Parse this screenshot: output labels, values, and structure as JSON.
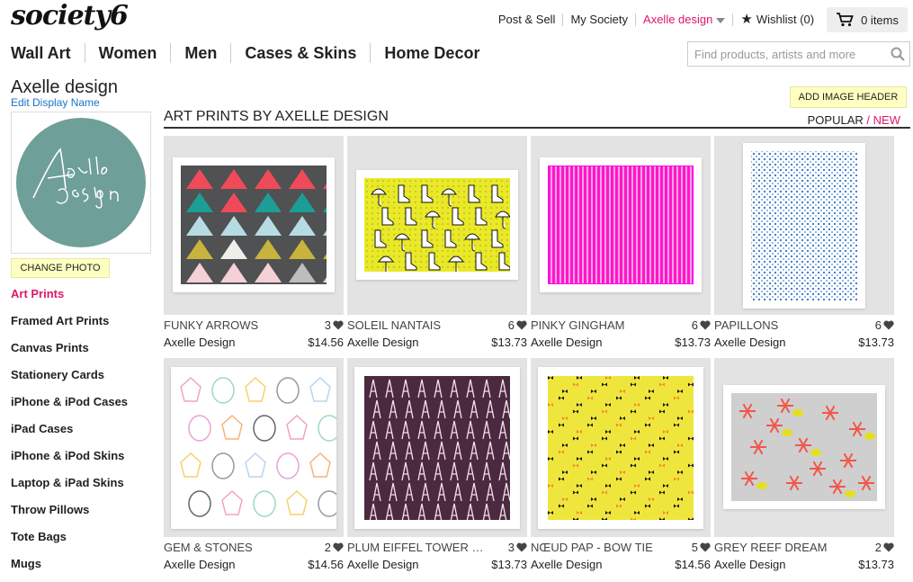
{
  "brand": {
    "logo": "society6"
  },
  "topnav": {
    "post_sell": "Post & Sell",
    "my_society": "My Society",
    "user": "Axelle design",
    "wishlist": "Wishlist (0)",
    "cart": "0 items"
  },
  "mainnav": [
    "Wall Art",
    "Women",
    "Men",
    "Cases & Skins",
    "Home Decor"
  ],
  "search": {
    "placeholder": "Find products, artists and more",
    "value": ""
  },
  "artist": {
    "name": "Axelle design",
    "edit_label": "Edit Display Name",
    "change_photo": "CHANGE PHOTO",
    "avatar_color": "#6e9f98"
  },
  "sidebar": [
    "Art Prints",
    "Framed Art Prints",
    "Canvas Prints",
    "Stationery Cards",
    "iPhone & iPod Cases",
    "iPad Cases",
    "iPhone & iPod Skins",
    "Laptop & iPad Skins",
    "Throw Pillows",
    "Tote Bags",
    "Mugs"
  ],
  "main": {
    "add_image_header": "ADD IMAGE HEADER",
    "section_title": "ART PRINTS BY AXELLE DESIGN",
    "sort_popular": "POPULAR",
    "sort_sep": "/",
    "sort_new": "NEW"
  },
  "colors": {
    "accent": "#e0166a",
    "link": "#1a73c8",
    "highlight": "#ffffc2"
  },
  "products": [
    {
      "title": "FUNKY ARROWS",
      "likes": "3",
      "artist": "Axelle Design",
      "price": "$14.56",
      "pattern": "triangles"
    },
    {
      "title": "SOLEIL NANTAIS",
      "likes": "6",
      "artist": "Axelle Design",
      "price": "$13.73",
      "pattern": "boots"
    },
    {
      "title": "PINKY GINGHAM",
      "likes": "6",
      "artist": "Axelle Design",
      "price": "$13.73",
      "pattern": "gingham"
    },
    {
      "title": "PAPILLONS",
      "likes": "6",
      "artist": "Axelle Design",
      "price": "$13.73",
      "pattern": "papillons"
    },
    {
      "title": "GEM & STONES",
      "likes": "2",
      "artist": "Axelle Design",
      "price": "$14.56",
      "pattern": "gems"
    },
    {
      "title": "PLUM EIFFEL TOWER & ...",
      "likes": "3",
      "artist": "Axelle Design",
      "price": "$13.73",
      "pattern": "eiffel"
    },
    {
      "title": "NŒUD PAP - BOW TIE",
      "likes": "5",
      "artist": "Axelle Design",
      "price": "$14.56",
      "pattern": "bowtie"
    },
    {
      "title": "GREY REEF DREAM",
      "likes": "2",
      "artist": "Axelle Design",
      "price": "$13.73",
      "pattern": "reef"
    }
  ]
}
